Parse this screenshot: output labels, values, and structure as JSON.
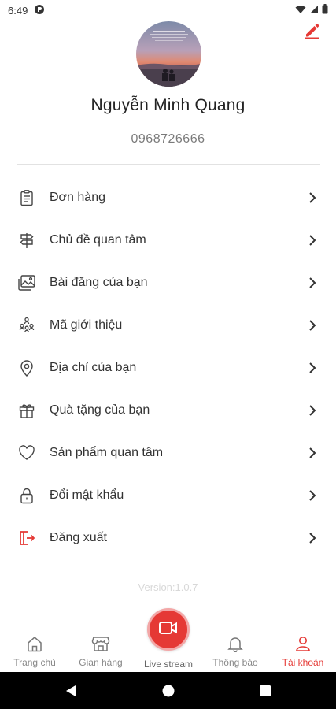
{
  "status_bar": {
    "time": "6:49"
  },
  "profile": {
    "name": "Nguyễn Minh Quang",
    "phone": "0968726666"
  },
  "menu": {
    "items": [
      {
        "label": "Đơn hàng",
        "icon": "clipboard-list-icon"
      },
      {
        "label": "Chủ đề quan tâm",
        "icon": "signpost-icon"
      },
      {
        "label": "Bài đăng của bạn",
        "icon": "image-icon"
      },
      {
        "label": "Mã giới thiệu",
        "icon": "referral-network-icon"
      },
      {
        "label": "Địa chỉ của bạn",
        "icon": "location-pin-icon"
      },
      {
        "label": "Quà tặng của bạn",
        "icon": "gift-icon"
      },
      {
        "label": "Sản phẩm quan tâm",
        "icon": "heart-icon"
      },
      {
        "label": "Đổi mật khẩu",
        "icon": "lock-icon"
      },
      {
        "label": "Đăng xuất",
        "icon": "logout-icon"
      }
    ]
  },
  "version": "Version:1.0.7",
  "bottom_nav": {
    "items": [
      {
        "label": "Trang chủ",
        "icon": "home-icon"
      },
      {
        "label": "Gian hàng",
        "icon": "store-icon"
      },
      {
        "label": "Live stream",
        "icon": "video-camera-icon"
      },
      {
        "label": "Thông báo",
        "icon": "bell-icon"
      },
      {
        "label": "Tài khoản",
        "icon": "user-icon",
        "active": true
      }
    ]
  },
  "colors": {
    "accent": "#e53935",
    "text": "#333333",
    "muted": "#7a7a7a",
    "live_ring": "#f3a7a7"
  }
}
